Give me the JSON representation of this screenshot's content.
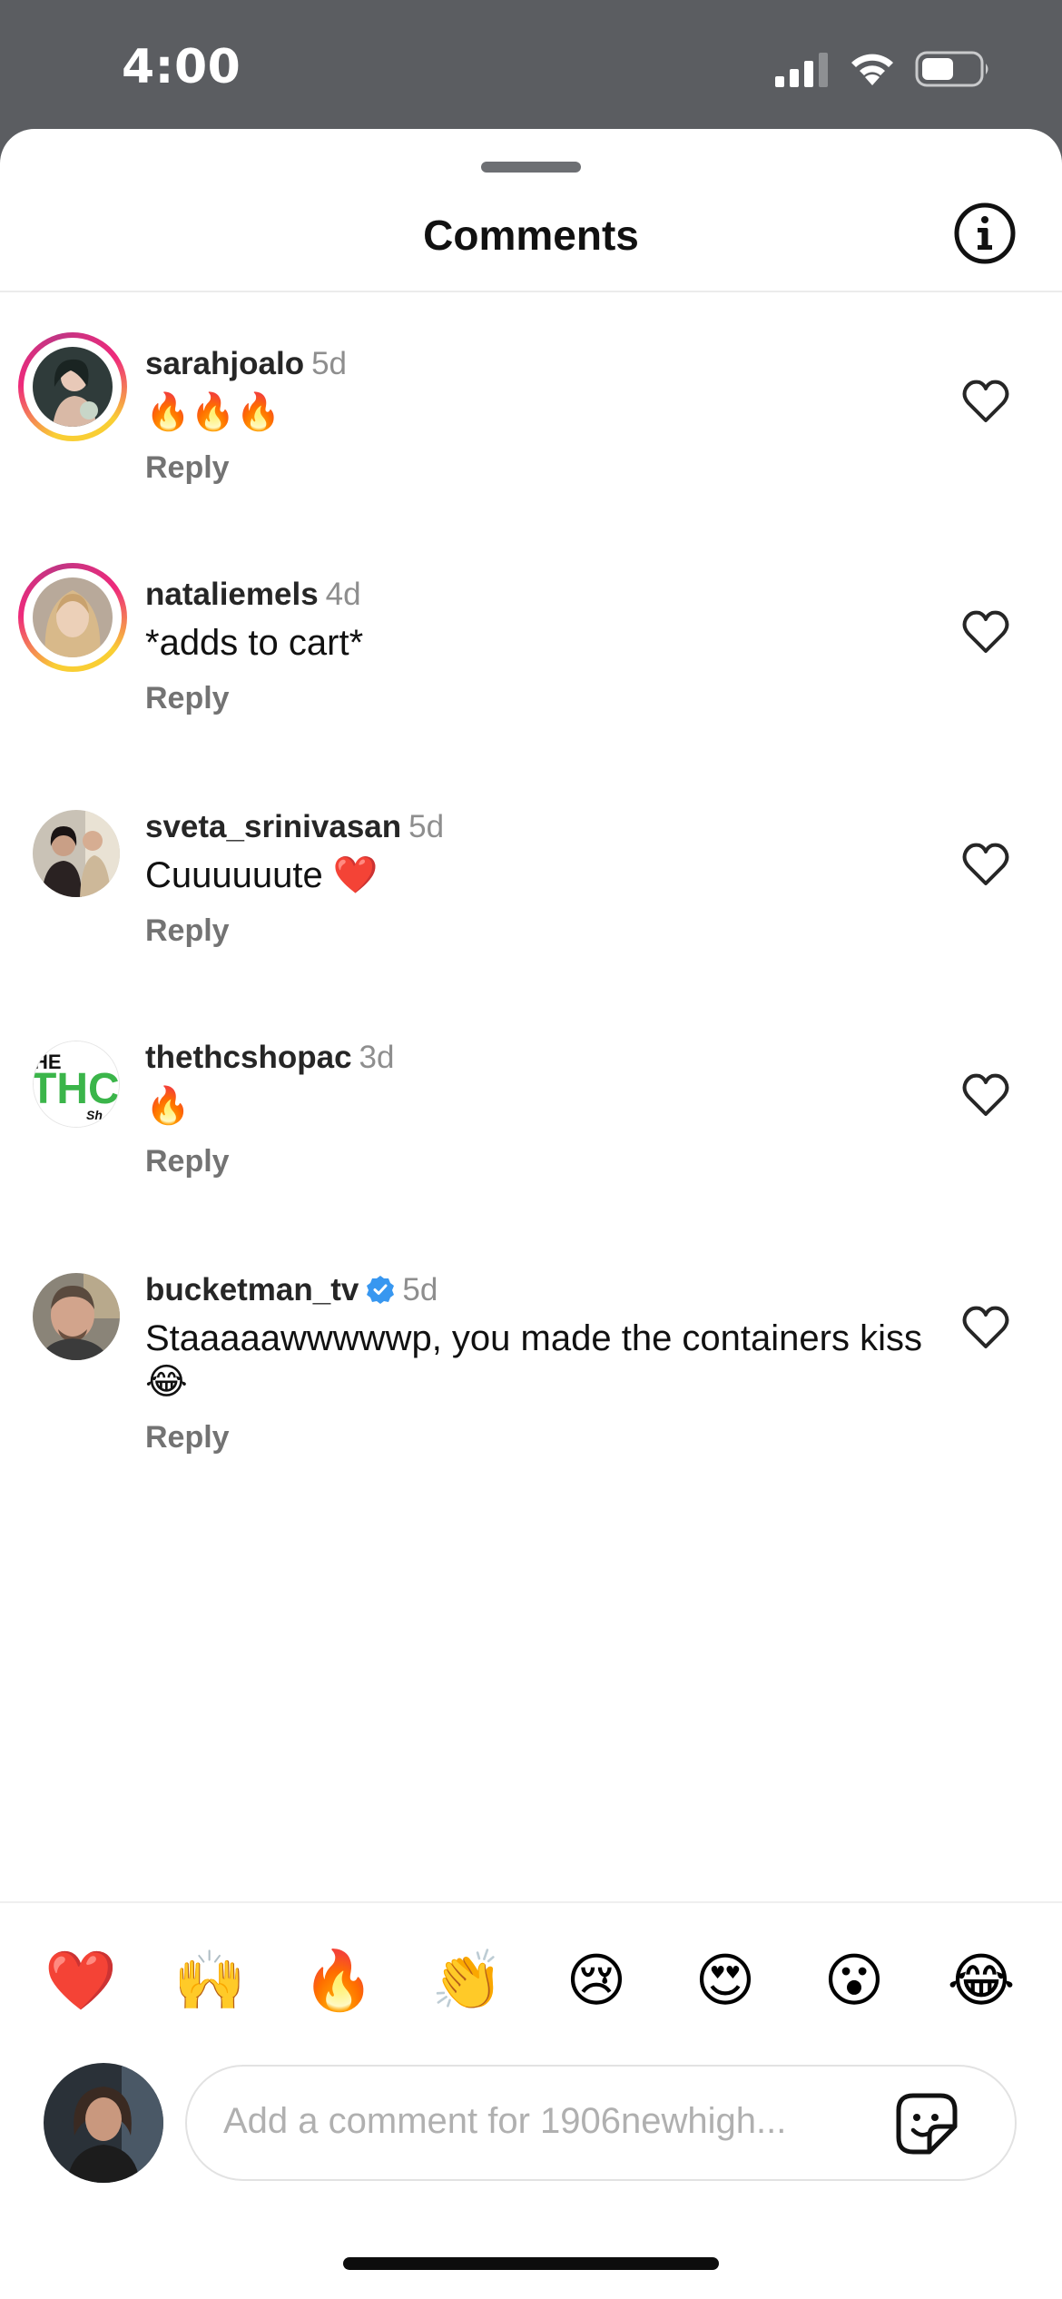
{
  "status_bar": {
    "time": "4:00"
  },
  "header": {
    "title": "Comments"
  },
  "comments": [
    {
      "username": "sarahjoalo",
      "time": "5d",
      "text": "🔥🔥🔥",
      "reply_label": "Reply",
      "has_story_ring": true
    },
    {
      "username": "nataliemels",
      "time": "4d",
      "text": "*adds to cart*",
      "reply_label": "Reply",
      "has_story_ring": true
    },
    {
      "username": "sveta_srinivasan",
      "time": "5d",
      "text": "Cuuuuuute ❤️",
      "reply_label": "Reply",
      "has_story_ring": false
    },
    {
      "username": "thethcshopac",
      "time": "3d",
      "text": "🔥",
      "reply_label": "Reply",
      "has_story_ring": false
    },
    {
      "username": "bucketman_tv",
      "time": "5d",
      "text": "Staaaaawwwwwp, you made the containers kiss 😂",
      "reply_label": "Reply",
      "has_story_ring": false,
      "verified": true
    }
  ],
  "quick_reactions": [
    "❤️",
    "🙌",
    "🔥",
    "👏",
    "😢",
    "😍",
    "😮",
    "😂"
  ],
  "composer": {
    "placeholder": "Add a comment for 1906newhigh..."
  },
  "colors": {
    "verified_badge": "#3897f0",
    "secondary_text": "#8e8e8e"
  }
}
